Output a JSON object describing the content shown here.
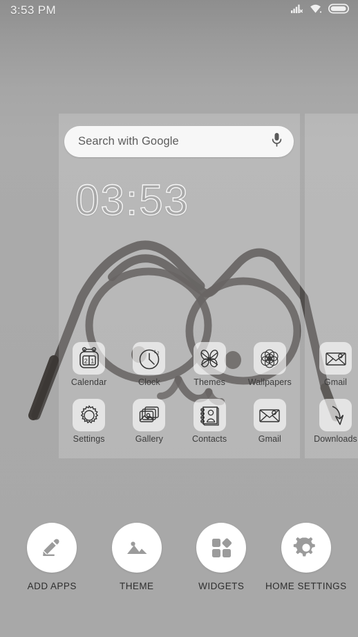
{
  "status_bar": {
    "time": "3:53  PM",
    "icons": [
      {
        "name": "signal-no-sim-icon",
        "label": "signal"
      },
      {
        "name": "wifi-icon",
        "label": "wifi"
      },
      {
        "name": "battery-icon",
        "label": "battery"
      }
    ]
  },
  "wallpaper": {
    "description": "hand-drawn cat face line art",
    "stroke_color": "#4a4644",
    "background_color": "#a8a8a8"
  },
  "search": {
    "placeholder": "Search with Google",
    "mic_icon": "microphone-icon"
  },
  "clock_widget": {
    "time": "03:53"
  },
  "pages": [
    {
      "id": "page-1",
      "rows": [
        [
          {
            "label": "Calendar",
            "icon": "calendar-icon"
          },
          {
            "label": "Clock",
            "icon": "clock-icon"
          },
          {
            "label": "Themes",
            "icon": "themes-butterfly-icon"
          },
          {
            "label": "Wallpapers",
            "icon": "wallpapers-rosette-icon"
          }
        ],
        [
          {
            "label": "Settings",
            "icon": "settings-gear-icon"
          },
          {
            "label": "Gallery",
            "icon": "gallery-photos-icon"
          },
          {
            "label": "Contacts",
            "icon": "contacts-book-icon"
          },
          {
            "label": "Gmail",
            "icon": "gmail-envelope-icon"
          }
        ]
      ]
    },
    {
      "id": "page-2",
      "rows": [
        [
          {
            "label": "Gmail",
            "icon": "gmail-envelope-icon"
          }
        ],
        [
          {
            "label": "Downloads",
            "icon": "downloads-arrow-icon"
          }
        ]
      ]
    }
  ],
  "toolbar": {
    "items": [
      {
        "label": "ADD APPS",
        "icon": "pencil-icon"
      },
      {
        "label": "THEME",
        "icon": "image-icon"
      },
      {
        "label": "WIDGETS",
        "icon": "widgets-squares-icon"
      },
      {
        "label": "HOME SETTINGS",
        "icon": "gear-icon"
      }
    ]
  },
  "colors": {
    "background": "#a8a8a8",
    "panel_overlay": "rgba(255,255,255,0.17)",
    "icon_tile": "rgba(255,255,255,0.62)",
    "toolbar_circle": "#ffffff",
    "text_dark": "#2e2e2e",
    "status_text": "#f2f2f2"
  }
}
